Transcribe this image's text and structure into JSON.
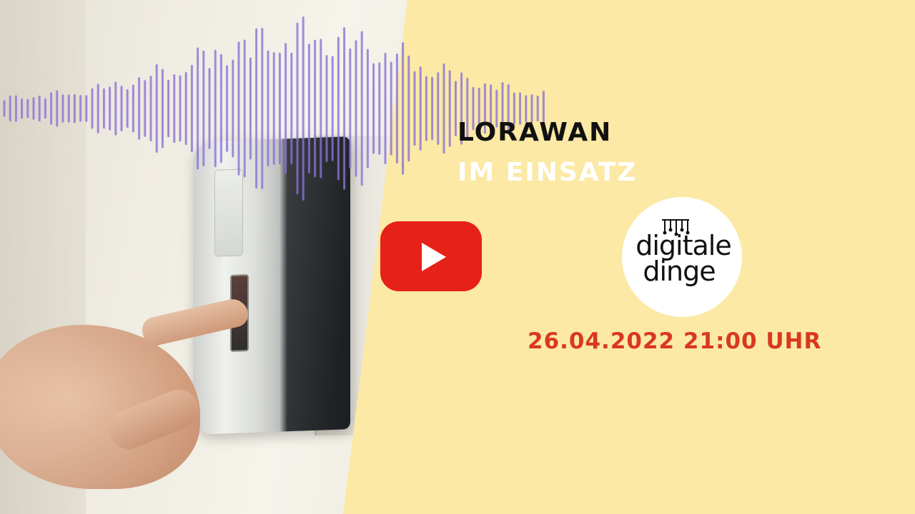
{
  "colors": {
    "background": "#fbe9a5",
    "wave": "#8a72d8",
    "title_dark": "#111111",
    "title_light": "#ffffff",
    "youtube_red": "#e62117",
    "date_red": "#d9381e"
  },
  "title": {
    "line1": "LORAWAN",
    "line2": "IM EINSATZ"
  },
  "logo": {
    "line1": "digitale",
    "line2": "dinge",
    "icon": "circuit-icon"
  },
  "youtube": {
    "icon": "youtube-play-icon"
  },
  "date": "26.04.2022 21:00 UHR"
}
